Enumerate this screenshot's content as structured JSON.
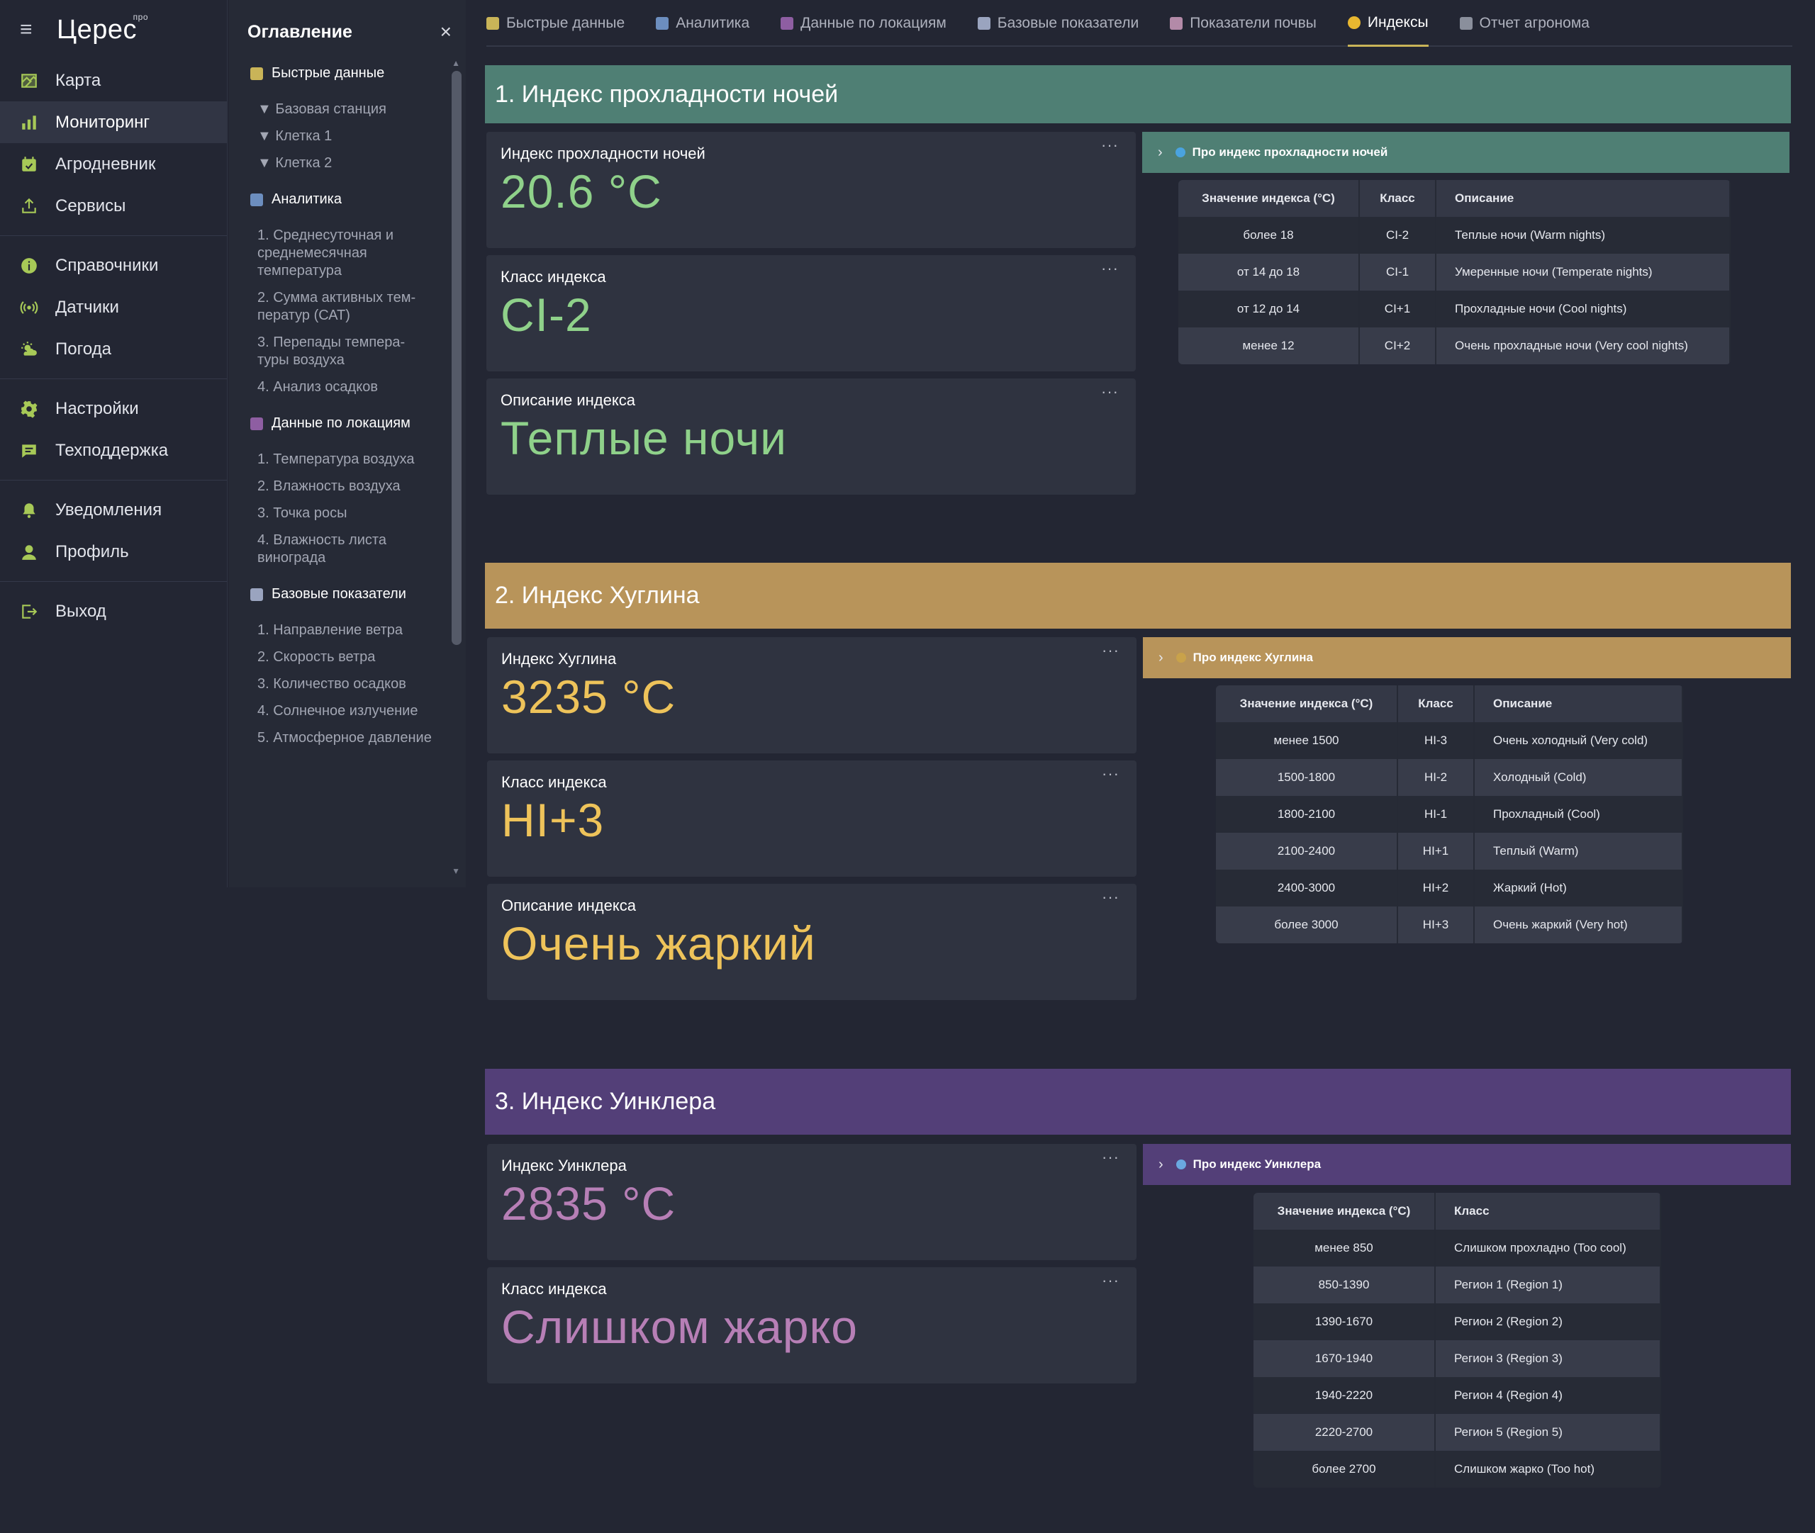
{
  "app": {
    "name": "Церес",
    "name_sup": "про"
  },
  "sidebar": {
    "groups": [
      [
        {
          "label": "Карта",
          "icon": "map-icon"
        },
        {
          "label": "Мониторинг",
          "icon": "bar-chart-icon",
          "active": true
        },
        {
          "label": "Агродневник",
          "icon": "calendar-icon"
        },
        {
          "label": "Сервисы",
          "icon": "upload-icon"
        }
      ],
      [
        {
          "label": "Справочники",
          "icon": "info-icon"
        },
        {
          "label": "Датчики",
          "icon": "signal-icon"
        },
        {
          "label": "Погода",
          "icon": "weather-icon"
        }
      ],
      [
        {
          "label": "Настройки",
          "icon": "gear-icon"
        },
        {
          "label": "Техподдержка",
          "icon": "chat-icon"
        }
      ],
      [
        {
          "label": "Уведомления",
          "icon": "bell-icon"
        },
        {
          "label": "Профиль",
          "icon": "user-icon"
        }
      ],
      [
        {
          "label": "Выход",
          "icon": "logout-icon"
        }
      ]
    ]
  },
  "toc": {
    "title": "Оглавление",
    "close": "×",
    "sections": [
      {
        "label": "Быстрые данные",
        "icon": "hourglass-icon",
        "color": "#c9b458",
        "items": [
          "▼ Базовая станция",
          "▼ Клетка 1",
          "▼ Клетка 2"
        ]
      },
      {
        "label": "Аналитика",
        "icon": "chart-icon",
        "color": "#6c8ebf",
        "items": [
          "1. Среднесуточная и среднемесячная температура",
          "2. Сумма активных тем-ператур (САТ)",
          "3. Перепады темпера-туры воздуха",
          "4. Анализ осадков"
        ]
      },
      {
        "label": "Данные по локациям",
        "icon": "grapes-icon",
        "color": "#8e5ea2",
        "items": [
          "1. Температура воздуха",
          "2. Влажность воздуха",
          "3. Точка росы",
          "4. Влажность листа винограда"
        ]
      },
      {
        "label": "Базовые показатели",
        "icon": "chart-up-icon",
        "color": "#9aa4bf",
        "items": [
          "1. Направление ветра",
          "2. Скорость ветра",
          "3. Количество осадков",
          "4. Солнечное излучение",
          "5. Атмосферное давление"
        ]
      }
    ]
  },
  "tabs": [
    {
      "label": "Быстрые данные",
      "icon": "hourglass-icon",
      "color": "#c9b458"
    },
    {
      "label": "Аналитика",
      "icon": "chart-icon",
      "color": "#6c8ebf"
    },
    {
      "label": "Данные по локациям",
      "icon": "grapes-icon",
      "color": "#8e5ea2"
    },
    {
      "label": "Базовые показатели",
      "icon": "chart-up-icon",
      "color": "#9aa4bf"
    },
    {
      "label": "Показатели почвы",
      "icon": "chart-down-icon",
      "color": "#b38aa8"
    },
    {
      "label": "Индексы",
      "icon": "sun-icon",
      "color": "#e8b730",
      "active": true
    },
    {
      "label": "Отчет агронома",
      "icon": "clipboard-icon",
      "color": "#8a8f9c"
    }
  ],
  "sections": [
    {
      "title": "1. Индекс прохладности ночей",
      "banner_color": "#4f7f74",
      "value_color": "#8fd18a",
      "about": {
        "label": "Про индекс прохладности ночей",
        "icon": "globe-icon",
        "icon_color": "#4aa3df"
      },
      "metrics": [
        {
          "label": "Индекс прохладности ночей",
          "value": "20.6 °C"
        },
        {
          "label": "Класс индекса",
          "value": "CI-2"
        },
        {
          "label": "Описание индекса",
          "value": "Теплые ночи"
        }
      ],
      "table": {
        "headers": [
          "Значение индекса (°С)",
          "Класс",
          "Описание"
        ],
        "rows": [
          [
            "более 18",
            "CI-2",
            "Теплые ночи (Warm nights)"
          ],
          [
            "от 14 до 18",
            "CI-1",
            "Умеренные ночи (Temperate nights)"
          ],
          [
            "от 12 до 14",
            "CI+1",
            "Прохладные ночи (Cool nights)"
          ],
          [
            "менее 12",
            "CI+2",
            "Очень прохладные ночи (Very cool nights)"
          ]
        ]
      }
    },
    {
      "title": "2. Индекс Хуглина",
      "banner_color": "#b8945a",
      "value_color": "#eec35a",
      "about": {
        "label": "Про индекс Хуглина",
        "icon": "magnifier-icon",
        "icon_color": "#c9a24a"
      },
      "metrics": [
        {
          "label": "Индекс Хуглина",
          "value": "3235 °C"
        },
        {
          "label": "Класс индекса",
          "value": "HI+3"
        },
        {
          "label": "Описание индекса",
          "value": "Очень жаркий"
        }
      ],
      "table": {
        "headers": [
          "Значение индекса (°С)",
          "Класс",
          "Описание"
        ],
        "rows": [
          [
            "менее 1500",
            "HI-3",
            "Очень холодный (Very cold)"
          ],
          [
            "1500-1800",
            "HI-2",
            "Холодный (Cold)"
          ],
          [
            "1800-2100",
            "HI-1",
            "Прохладный (Cool)"
          ],
          [
            "2100-2400",
            "HI+1",
            "Теплый (Warm)"
          ],
          [
            "2400-3000",
            "HI+2",
            "Жаркий (Hot)"
          ],
          [
            "более 3000",
            "HI+3",
            "Очень жаркий (Very hot)"
          ]
        ]
      }
    },
    {
      "title": "3. Индекс Уинклера",
      "banner_color": "#533f78",
      "value_color": "#b77fb6",
      "about": {
        "label": "Про индекс Уинклера",
        "icon": "magnifier-icon",
        "icon_color": "#6aa8e0"
      },
      "metrics": [
        {
          "label": "Индекс Уинклера",
          "value": "2835 °C"
        },
        {
          "label": "Класс индекса",
          "value": "Слишком жарко"
        }
      ],
      "table": {
        "headers": [
          "Значение индекса (°С)",
          "Класс"
        ],
        "rows": [
          [
            "менее 850",
            "Слишком прохладно (Too cool)"
          ],
          [
            "850-1390",
            "Регион 1 (Region 1)"
          ],
          [
            "1390-1670",
            "Регион 2 (Region 2)"
          ],
          [
            "1670-1940",
            "Регион 3 (Region 3)"
          ],
          [
            "1940-2220",
            "Регион 4 (Region 4)"
          ],
          [
            "2220-2700",
            "Регион 5 (Region 5)"
          ],
          [
            "более 2700",
            "Слишком жарко (Too hot)"
          ]
        ]
      }
    }
  ],
  "menu_dots": "···"
}
